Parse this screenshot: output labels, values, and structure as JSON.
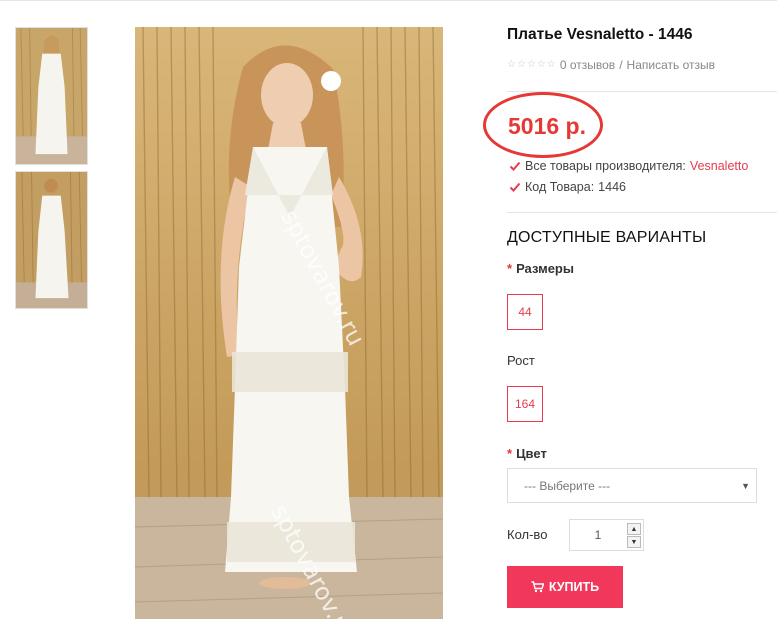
{
  "product": {
    "title": "Платье Vesnaletto - 1446",
    "rating": {
      "stars": 0,
      "max_stars": 5,
      "reviews_label": "0 отзывов",
      "separator": "/",
      "write_review_label": "Написать отзыв"
    },
    "price": "5016 р.",
    "manufacturer_label": "Все товары производителя:",
    "manufacturer_name": "Vesnaletto",
    "code_label": "Код Товара:",
    "code_value": "1446"
  },
  "gallery": {
    "watermark": "sptovarov.ru"
  },
  "options": {
    "heading": "ДОСТУПНЫЕ ВАРИАНТЫ",
    "size": {
      "label": "Размеры",
      "required": true,
      "values": [
        "44"
      ]
    },
    "height": {
      "label": "Рост",
      "required": false,
      "values": [
        "164"
      ]
    },
    "color": {
      "label": "Цвет",
      "required": true,
      "placeholder": "--- Выберите ---"
    }
  },
  "quantity": {
    "label": "Кол-во",
    "value": "1"
  },
  "buy_button_label": "КУПИТЬ",
  "colors": {
    "accent": "#e53c4f",
    "price": "#e53935",
    "button": "#f1375a"
  },
  "icons": {
    "check": "check-icon",
    "cart": "cart-icon",
    "star": "star-icon",
    "caret": "caret-down-icon"
  }
}
